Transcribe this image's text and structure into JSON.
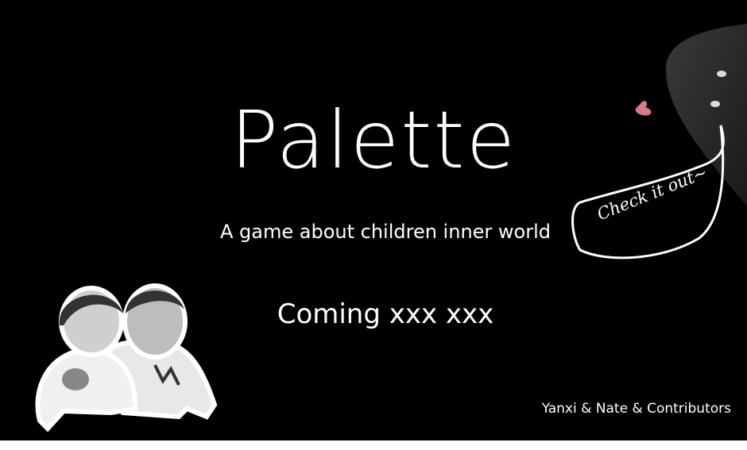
{
  "title": "Palette",
  "subtitle": "A game about children inner world",
  "release": "Coming xxx xxx",
  "speech_bubble": "Check it out~",
  "credits": "Yanxi & Nate & Contributors",
  "colors": {
    "background": "#000000",
    "text": "#ffffff",
    "heart": "#d9788a",
    "creature": "#2e2e2e"
  }
}
